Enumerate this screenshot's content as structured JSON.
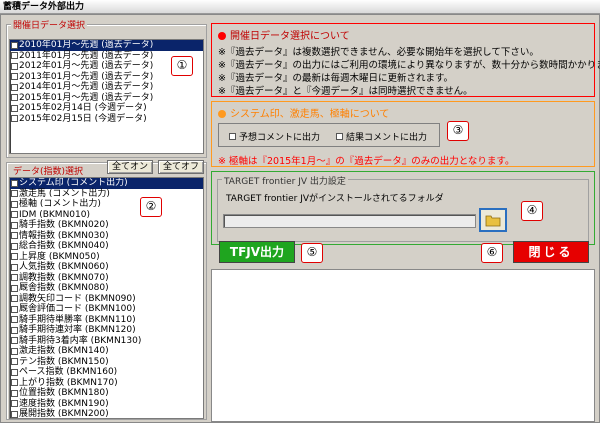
{
  "window": {
    "title": "蓄積データ外部出力"
  },
  "colors": {
    "selected": "#0a246a",
    "red": "#ff0000",
    "orange": "#ff9a20",
    "green": "#33aa33",
    "callout": "#e00000"
  },
  "date_group": {
    "title": "開催日データ選択",
    "items": [
      {
        "label": "2010年01月〜先週 (過去データ)",
        "selected": true
      },
      {
        "label": "2011年01月〜先週 (過去データ)",
        "selected": false
      },
      {
        "label": "2012年01月〜先週 (過去データ)",
        "selected": false
      },
      {
        "label": "2013年01月〜先週 (過去データ)",
        "selected": false
      },
      {
        "label": "2014年01月〜先週 (過去データ)",
        "selected": false
      },
      {
        "label": "2015年01月〜先週 (過去データ)",
        "selected": false
      },
      {
        "label": "2015年02月14日 (今週データ)",
        "selected": false
      },
      {
        "label": "2015年02月15日 (今週データ)",
        "selected": false
      }
    ]
  },
  "data_group": {
    "title": "データ(指数)選択",
    "all_on_label": "全てオン",
    "all_off_label": "全てオフ",
    "items": [
      {
        "label": "システム印 (コメント出力)",
        "selected": true
      },
      {
        "label": "激走馬 (コメント出力)",
        "selected": false
      },
      {
        "label": "極軸 (コメント出力)",
        "selected": false
      },
      {
        "label": "IDM (BKMN010)",
        "selected": false
      },
      {
        "label": "騎手指数 (BKMN020)",
        "selected": false
      },
      {
        "label": "情報指数 (BKMN030)",
        "selected": false
      },
      {
        "label": "総合指数 (BKMN040)",
        "selected": false
      },
      {
        "label": "上昇度 (BKMN050)",
        "selected": false
      },
      {
        "label": "人気指数 (BKMN060)",
        "selected": false
      },
      {
        "label": "調教指数 (BKMN070)",
        "selected": false
      },
      {
        "label": "厩舎指数 (BKMN080)",
        "selected": false
      },
      {
        "label": "調教矢印コード (BKMN090)",
        "selected": false
      },
      {
        "label": "厩舎評価コード (BKMN100)",
        "selected": false
      },
      {
        "label": "騎手期待単勝率 (BKMN110)",
        "selected": false
      },
      {
        "label": "騎手期待連対率 (BKMN120)",
        "selected": false
      },
      {
        "label": "騎手期待3着内率 (BKMN130)",
        "selected": false
      },
      {
        "label": "激走指数 (BKMN140)",
        "selected": false
      },
      {
        "label": "テン指数 (BKMN150)",
        "selected": false
      },
      {
        "label": "ペース指数 (BKMN160)",
        "selected": false
      },
      {
        "label": "上がり指数 (BKMN170)",
        "selected": false
      },
      {
        "label": "位置指数 (BKMN180)",
        "selected": false
      },
      {
        "label": "速度指数 (BKMN190)",
        "selected": false
      },
      {
        "label": "展開指数 (BKMN200)",
        "selected": false
      }
    ]
  },
  "info_date": {
    "title": "開催日データ選択について",
    "lines": [
      "※『過去データ』は複数選択できません、必要な開始年を選択して下さい。",
      "※『過去データ』の出力にはご利用の環境により異なりますが、数十分から数時間かかります。",
      "※『過去データ』の最新は毎週木曜日に更新されます。",
      "※『過去データ』と『今週データ』は同時選択できません。"
    ]
  },
  "info_system": {
    "title": "システム印、激走馬、極軸について",
    "check1": "予想コメントに出力",
    "check2": "結果コメントに出力",
    "note": "※ 極軸は『2015年1月〜』の『過去データ』のみの出力となります。"
  },
  "target_group": {
    "title": "TARGET frontier JV 出力設定",
    "label": "TARGET frontier JVがインストールされてるフォルダ",
    "path_value": ""
  },
  "buttons": {
    "tfjv": "TFJV出力",
    "close": "閉じる"
  },
  "callouts": [
    "①",
    "②",
    "③",
    "④",
    "⑤",
    "⑥"
  ]
}
